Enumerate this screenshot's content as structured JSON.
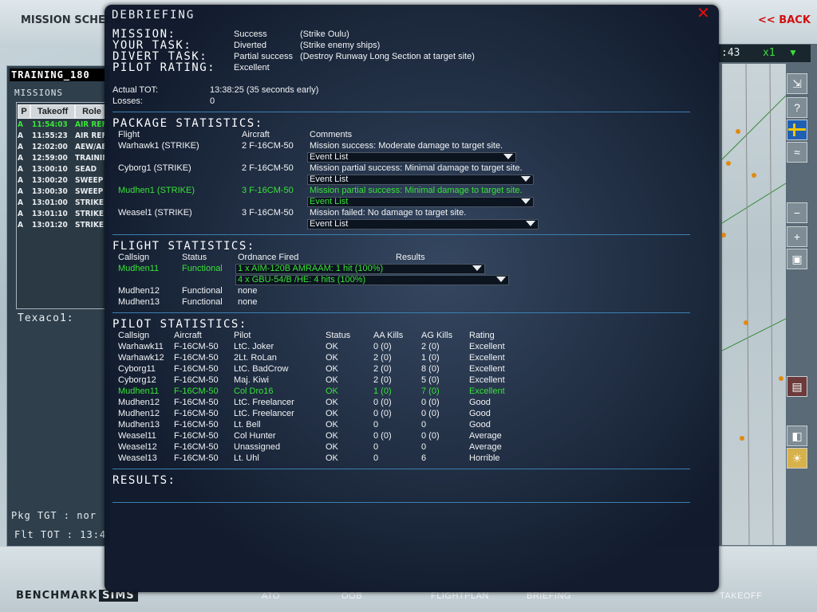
{
  "background": {
    "schedule_title": "MISSION SCHEDU",
    "back_label": "<< BACK",
    "training_label": "TRAINING_180",
    "missions_label": "MISSIONS",
    "mission_columns": [
      "P",
      "Takeoff",
      "Role"
    ],
    "missions": [
      {
        "p": "A",
        "takeoff": "11:54:03",
        "role": "AIR REF",
        "highlight": true
      },
      {
        "p": "A",
        "takeoff": "11:55:23",
        "role": "AIR REF",
        "highlight": false
      },
      {
        "p": "A",
        "takeoff": "12:02:00",
        "role": "AEW/AE",
        "highlight": false
      },
      {
        "p": "A",
        "takeoff": "12:59:00",
        "role": "TRAININ",
        "highlight": false
      },
      {
        "p": "A",
        "takeoff": "13:00:10",
        "role": "SEAD",
        "highlight": false
      },
      {
        "p": "A",
        "takeoff": "13:00:20",
        "role": "SWEEP",
        "highlight": false
      },
      {
        "p": "A",
        "takeoff": "13:00:30",
        "role": "SWEEP",
        "highlight": false
      },
      {
        "p": "A",
        "takeoff": "13:01:00",
        "role": "STRIKE",
        "highlight": false
      },
      {
        "p": "A",
        "takeoff": "13:01:10",
        "role": "STRIKE",
        "highlight": false
      },
      {
        "p": "A",
        "takeoff": "13:01:20",
        "role": "STRIKE",
        "highlight": false
      }
    ],
    "texaco": "Texaco1:",
    "pkg_tgt": "Pkg TGT  :  nor",
    "flt_tot": "Flt TOT  :  13:4",
    "clock": ":43",
    "speed": "x1",
    "logo_bench": "BENCHMARK",
    "logo_sims": "SIMS",
    "nav_tabs": [
      "ATO",
      "OOB",
      "FLIGHTPLAN",
      "BRIEFING",
      "TAKEOFF"
    ]
  },
  "dialog": {
    "title": "DEBRIEFING",
    "summary": [
      {
        "label": "MISSION:",
        "value": "Success",
        "detail": "(Strike Oulu)"
      },
      {
        "label": "YOUR TASK:",
        "value": "Diverted",
        "detail": "(Strike enemy ships)"
      },
      {
        "label": "DIVERT TASK:",
        "value": "Partial success",
        "detail": "(Destroy Runway Long Section at target site)"
      },
      {
        "label": "PILOT RATING:",
        "value": "Excellent",
        "detail": ""
      }
    ],
    "actual_tot_label": "Actual TOT:",
    "actual_tot_value": "13:38:25 (35 seconds early)",
    "losses_label": "Losses:",
    "losses_value": "0",
    "package": {
      "heading": "PACKAGE STATISTICS:",
      "headers": [
        "Flight",
        "Aircraft",
        "Comments"
      ],
      "rows": [
        {
          "flight": "Warhawk1 (STRIKE)",
          "aircraft": "2 F-16CM-50",
          "comment": "Mission success: Moderate damage to target site.",
          "event": "Event List",
          "highlight": false
        },
        {
          "flight": "Cyborg1 (STRIKE)",
          "aircraft": "2 F-16CM-50",
          "comment": "Mission partial success: Minimal damage to target site.",
          "event": "Event List",
          "highlight": false
        },
        {
          "flight": "Mudhen1 (STRIKE)",
          "aircraft": "3 F-16CM-50",
          "comment": "Mission partial success: Minimal damage to target site.",
          "event": "Event List",
          "highlight": true
        },
        {
          "flight": "Weasel1 (STRIKE)",
          "aircraft": "3 F-16CM-50",
          "comment": "Mission failed: No damage to target site.",
          "event": "Event List",
          "highlight": false
        }
      ]
    },
    "flight": {
      "heading": "FLIGHT STATISTICS:",
      "headers": [
        "Callsign",
        "Status",
        "Ordnance Fired",
        "Results"
      ],
      "rows": [
        {
          "callsign": "Mudhen11",
          "status": "Functional",
          "ordnance": [
            "1 x AIM-120B AMRAAM: 1 hit (100%)",
            "4 x GBU-54/B /HE: 4 hits (100%)"
          ],
          "highlight": true
        },
        {
          "callsign": "Mudhen12",
          "status": "Functional",
          "ordnance": [
            "none"
          ],
          "highlight": false
        },
        {
          "callsign": "Mudhen13",
          "status": "Functional",
          "ordnance": [
            "none"
          ],
          "highlight": false
        }
      ]
    },
    "pilot": {
      "heading": "PILOT STATISTICS:",
      "headers": [
        "Callsign",
        "Aircraft",
        "Pilot",
        "Status",
        "AA Kills",
        "AG Kills",
        "Rating"
      ],
      "rows": [
        {
          "callsign": "Warhawk11",
          "aircraft": "F-16CM-50",
          "pilot": "LtC. Joker",
          "status": "OK",
          "aa": "0 (0)",
          "ag": "2 (0)",
          "rating": "Excellent",
          "highlight": false
        },
        {
          "callsign": "Warhawk12",
          "aircraft": "F-16CM-50",
          "pilot": "2Lt. RoLan",
          "status": "OK",
          "aa": "2 (0)",
          "ag": "1 (0)",
          "rating": "Excellent",
          "highlight": false
        },
        {
          "callsign": "Cyborg11",
          "aircraft": "F-16CM-50",
          "pilot": "LtC. BadCrow",
          "status": "OK",
          "aa": "2 (0)",
          "ag": "8 (0)",
          "rating": "Excellent",
          "highlight": false
        },
        {
          "callsign": "Cyborg12",
          "aircraft": "F-16CM-50",
          "pilot": "Maj. Kiwi",
          "status": "OK",
          "aa": "2 (0)",
          "ag": "5 (0)",
          "rating": "Excellent",
          "highlight": false
        },
        {
          "callsign": "Mudhen11",
          "aircraft": "F-16CM-50",
          "pilot": "Col Dro16",
          "status": "OK",
          "aa": "1 (0)",
          "ag": "7 (0)",
          "rating": "Excellent",
          "highlight": true
        },
        {
          "callsign": "Mudhen12",
          "aircraft": "F-16CM-50",
          "pilot": "LtC. Freelancer",
          "status": "OK",
          "aa": "0 (0)",
          "ag": "0 (0)",
          "rating": "Good",
          "highlight": false
        },
        {
          "callsign": "Mudhen12",
          "aircraft": "F-16CM-50",
          "pilot": "LtC. Freelancer",
          "status": "OK",
          "aa": "0 (0)",
          "ag": "0 (0)",
          "rating": "Good",
          "highlight": false
        },
        {
          "callsign": "Mudhen13",
          "aircraft": "F-16CM-50",
          "pilot": "Lt. Bell",
          "status": "OK",
          "aa": "0",
          "ag": "0",
          "rating": "Good",
          "highlight": false
        },
        {
          "callsign": "Weasel11",
          "aircraft": "F-16CM-50",
          "pilot": "Col Hunter",
          "status": "OK",
          "aa": "0 (0)",
          "ag": "0 (0)",
          "rating": "Average",
          "highlight": false
        },
        {
          "callsign": "Weasel12",
          "aircraft": "F-16CM-50",
          "pilot": "Unassigned",
          "status": "OK",
          "aa": "0",
          "ag": "0",
          "rating": "Average",
          "highlight": false
        },
        {
          "callsign": "Weasel13",
          "aircraft": "F-16CM-50",
          "pilot": "Lt. Uhl",
          "status": "OK",
          "aa": "0",
          "ag": "6",
          "rating": "Horrible",
          "highlight": false
        }
      ]
    },
    "results_heading": "RESULTS:"
  },
  "colors": {
    "highlight": "#39e339",
    "separator": "#3c7fb2",
    "close": "#e01010"
  }
}
